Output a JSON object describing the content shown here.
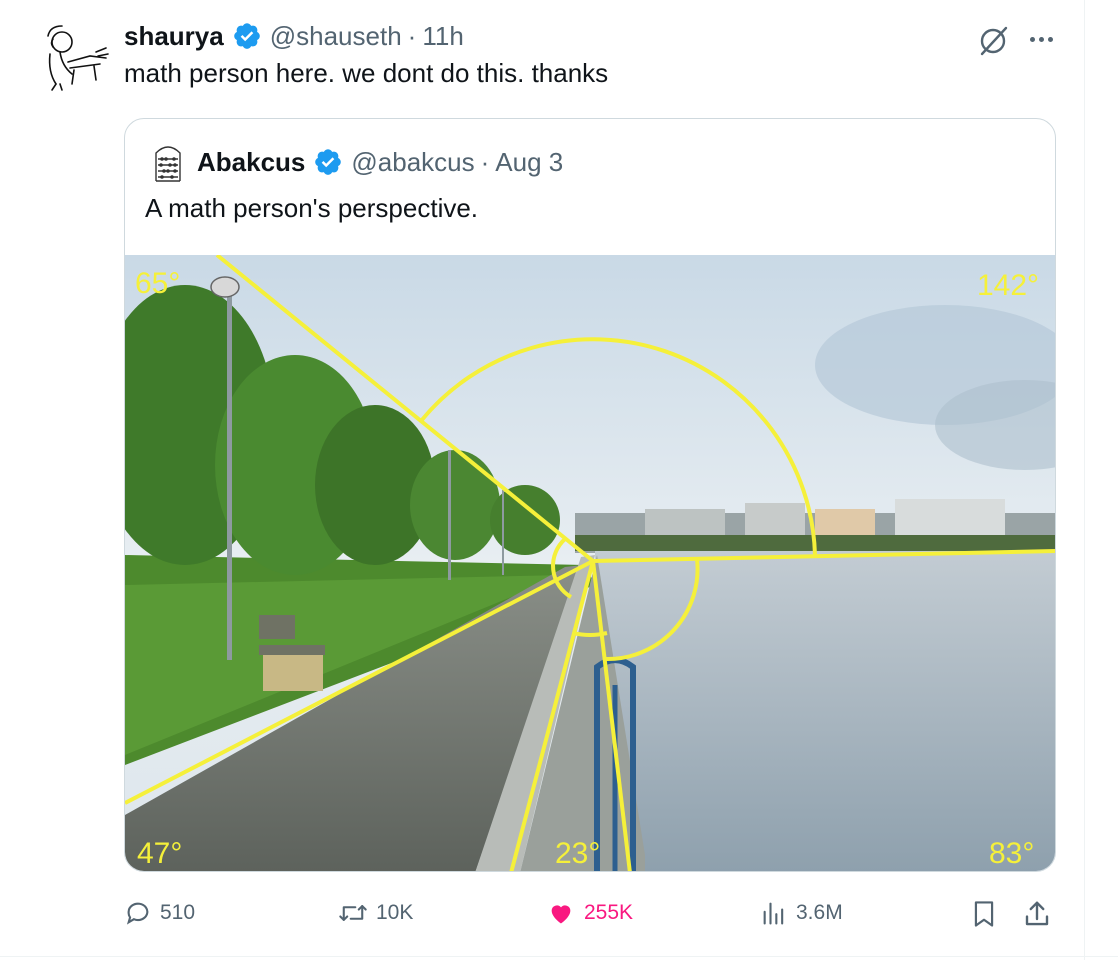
{
  "tweet": {
    "display_name": "shaurya",
    "handle": "@shauseth",
    "separator": "·",
    "time": "11h",
    "text": "math person here. we dont do this. thanks"
  },
  "quoted": {
    "display_name": "Abakcus",
    "handle": "@abakcus",
    "separator": "·",
    "date": "Aug 3",
    "text": "A math person's perspective."
  },
  "media": {
    "angle_labels": {
      "top_left": "65°",
      "top_right": "142°",
      "bottom_left": "47°",
      "bottom_center": "23°",
      "bottom_right": "83°"
    },
    "overlay_color": "#f5f03a"
  },
  "actions": {
    "replies": "510",
    "reposts": "10K",
    "likes": "255K",
    "views": "3.6M"
  },
  "colors": {
    "verified": "#1d9bf0",
    "like": "#f91880",
    "secondary_text": "#536471",
    "border": "#cfd9de"
  },
  "icons": [
    "grok-icon",
    "more-icon",
    "reply-icon",
    "repost-icon",
    "heart-icon",
    "views-icon",
    "bookmark-icon",
    "share-icon",
    "verified-badge-icon"
  ]
}
